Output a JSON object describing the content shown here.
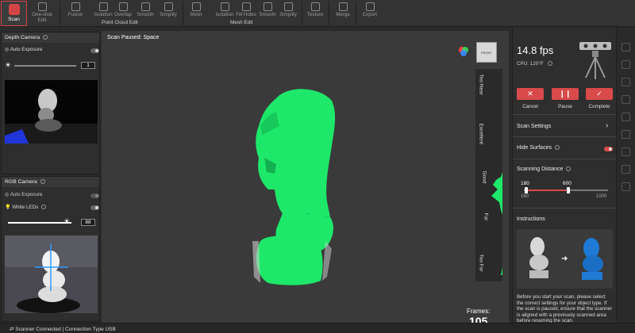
{
  "toolbar": {
    "scan": "Scan",
    "one_click_edit": "One-click Edit",
    "fusion": "Fusion",
    "isolation": "Isolation",
    "overlap": "Overlap",
    "smooth": "Smooth",
    "simplify": "Simplify",
    "mesh": "Mesh",
    "mesh_isolation": "Isolation",
    "fill_holes": "Fill Holes",
    "mesh_smooth": "Smooth",
    "mesh_simplify": "Simplify",
    "texture": "Texture",
    "merge": "Merge",
    "export": "Export",
    "group_point_cloud": "Point Cloud Edit",
    "group_mesh": "Mesh Edit"
  },
  "depth_camera": {
    "title": "Depth Camera",
    "auto_exposure": "Auto Exposure",
    "exposure_value": "1"
  },
  "rgb_camera": {
    "title": "RGB Camera",
    "auto_exposure": "Auto Exposure",
    "white_leds": "White LEDs",
    "brightness_value": "88"
  },
  "viewport": {
    "scan_status": "Scan Paused:",
    "scan_status_key": "Space",
    "frames_label": "Frames:",
    "frames_value": "105",
    "cube_label": "FRONT",
    "distance_labels": [
      "Too Near",
      "Excellent",
      "Good",
      "Far",
      "Too Far"
    ]
  },
  "right_panel": {
    "fps": "14.8 fps",
    "cpu": "CPU: 120°F",
    "cancel": "Cancel",
    "pause": "Pause",
    "complete": "Complete",
    "scan_settings": "Scan Settings",
    "hide_surfaces": "Hide Surfaces",
    "scanning_distance": "Scanning Distance",
    "dist_min_value": "180",
    "dist_max_value": "600",
    "dist_range_min": "160",
    "dist_range_max": "1000",
    "dist_low_fraction": 0.024,
    "dist_high_fraction": 0.524,
    "instructions": "Instructions",
    "instructions_text": "Before you start your scan, please select the correct settings for your object type. If the scan is paused, ensure that the scanner is aligned with a previously scanned area before resuming the scan."
  },
  "status_bar": {
    "text": "Scanner Connected | Connection Type USB"
  },
  "colors": {
    "accent_red": "#d94a4a",
    "scan_green": "#1ee86a",
    "sculpt_blue": "#1f7ad6"
  }
}
